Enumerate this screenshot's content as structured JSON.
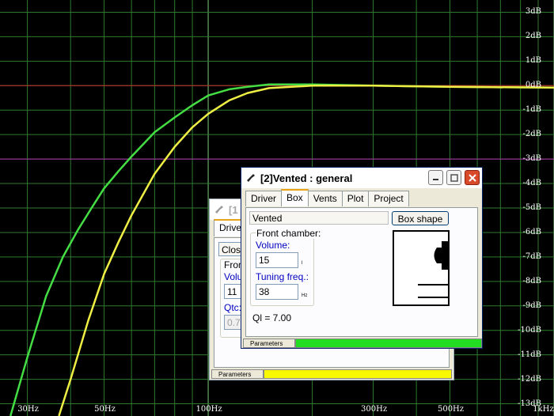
{
  "chart_data": {
    "type": "line",
    "x_scale": "log",
    "xlim": [
      25,
      1000
    ],
    "ylim": [
      -13.5,
      3.5
    ],
    "x_tick_labels": [
      {
        "value": 30,
        "label": "30Hz"
      },
      {
        "value": 50,
        "label": "50Hz"
      },
      {
        "value": 100,
        "label": "100Hz"
      },
      {
        "value": 300,
        "label": "300Hz"
      },
      {
        "value": 500,
        "label": "500Hz"
      },
      {
        "value": 1000,
        "label": "1kHz"
      }
    ],
    "y_tick_labels": [
      {
        "value": 3,
        "label": "3dB"
      },
      {
        "value": 2,
        "label": "2dB"
      },
      {
        "value": 1,
        "label": "1dB"
      },
      {
        "value": 0,
        "label": "0dB"
      },
      {
        "value": -1,
        "label": "-1dB"
      },
      {
        "value": -2,
        "label": "-2dB"
      },
      {
        "value": -3,
        "label": "-3dB"
      },
      {
        "value": -4,
        "label": "-4dB"
      },
      {
        "value": -5,
        "label": "-5dB"
      },
      {
        "value": -6,
        "label": "-6dB"
      },
      {
        "value": -7,
        "label": "-7dB"
      },
      {
        "value": -8,
        "label": "-8dB"
      },
      {
        "value": -9,
        "label": "-9dB"
      },
      {
        "value": -10,
        "label": "-10dB"
      },
      {
        "value": -11,
        "label": "-11dB"
      },
      {
        "value": -12,
        "label": "-12dB"
      },
      {
        "value": -13,
        "label": "-13dB"
      }
    ],
    "grid": true,
    "reference_lines": [
      {
        "y": 0,
        "color": "#cc2b2b"
      },
      {
        "y": -3,
        "color": "#b030b0"
      }
    ],
    "series": [
      {
        "color": "#44dd44",
        "x": [
          26.8,
          30,
          34,
          38,
          42,
          46,
          50,
          55,
          60,
          70,
          80,
          90,
          100,
          115,
          130,
          150,
          200,
          300,
          500,
          1000
        ],
        "y": [
          -13.5,
          -11.1,
          -8.6,
          -7.0,
          -5.9,
          -5.0,
          -4.2,
          -3.5,
          -2.9,
          -1.9,
          -1.3,
          -0.8,
          -0.4,
          -0.15,
          -0.05,
          0.05,
          0.05,
          0.0,
          -0.05,
          -0.08
        ]
      },
      {
        "color": "#eeee44",
        "x": [
          37,
          40,
          45,
          50,
          55,
          60,
          70,
          80,
          90,
          100,
          115,
          130,
          150,
          200,
          300,
          500,
          1000
        ],
        "y": [
          -13.5,
          -12.0,
          -9.6,
          -7.7,
          -6.4,
          -5.3,
          -3.6,
          -2.5,
          -1.7,
          -1.15,
          -0.6,
          -0.3,
          -0.1,
          0.0,
          0.0,
          -0.05,
          -0.08
        ]
      }
    ]
  },
  "back_window": {
    "title": "[1",
    "tab_label": "Driver",
    "combo_value": "Close",
    "group_label": "Fron",
    "volume_label": "Volu",
    "volume_value": "11",
    "qtc_label": "Qtc:",
    "qtc_value": "0.7",
    "status_label": "Parameters",
    "status_color": "#f8f800"
  },
  "front_window": {
    "title": "[2]Vented : general",
    "tabs": [
      "Driver",
      "Box",
      "Vents",
      "Plot",
      "Project"
    ],
    "selected_tab": "Box",
    "box_type": "Vented",
    "box_shape_button": "Box shape",
    "group_label": "Front chamber:",
    "volume_label": "Volume:",
    "volume_value": "15",
    "volume_unit": "l",
    "tuning_label": "Tuning freq.:",
    "tuning_value": "38",
    "tuning_unit": "Hz",
    "ql_text": "Ql = 7.00",
    "status_label": "Parameters",
    "status_color": "#22dd22"
  }
}
